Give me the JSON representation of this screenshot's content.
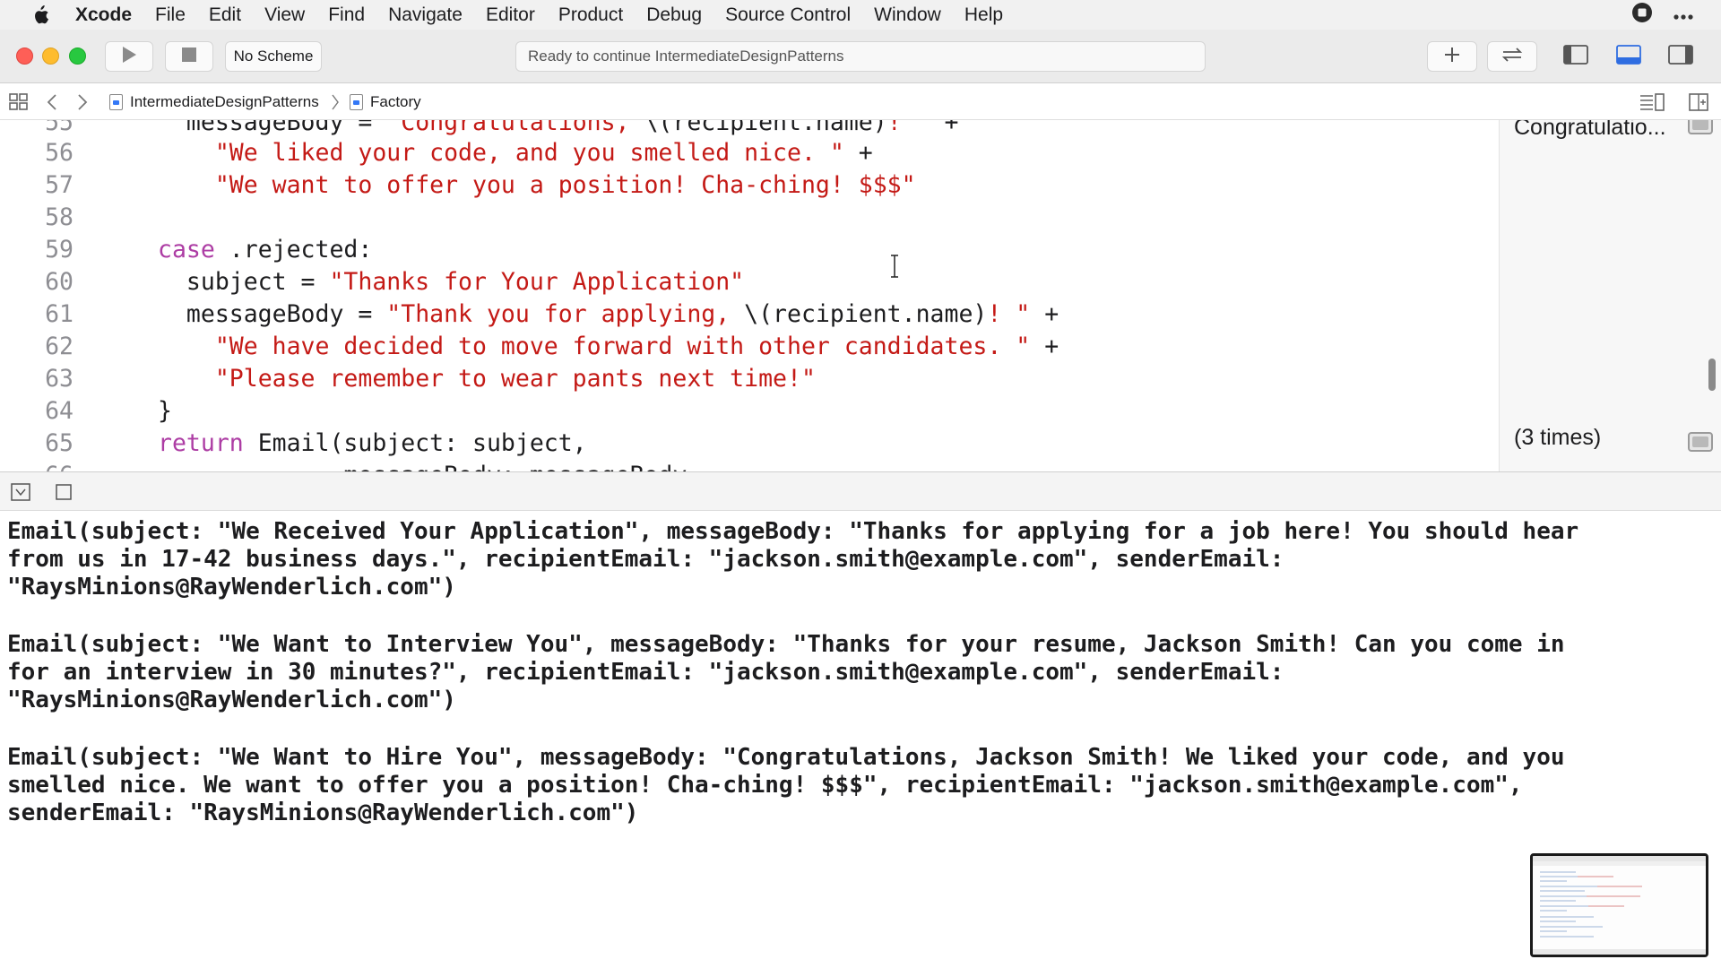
{
  "menubar": {
    "app_name": "Xcode",
    "items": [
      "File",
      "Edit",
      "View",
      "Find",
      "Navigate",
      "Editor",
      "Product",
      "Debug",
      "Source Control",
      "Window",
      "Help"
    ]
  },
  "toolbar": {
    "scheme_label": "No Scheme",
    "activity_status": "Ready to continue IntermediateDesignPatterns"
  },
  "jumpbar": {
    "project": "IntermediateDesignPatterns",
    "file": "Factory"
  },
  "editor": {
    "lines": [
      {
        "num": "55",
        "parts": [
          {
            "t": "  messageBody = ",
            "c": "plain"
          },
          {
            "t": "\"Congratulations, ",
            "c": "str"
          },
          {
            "t": "\\(recipient.name)",
            "c": "plain"
          },
          {
            "t": "! \"",
            "c": "str"
          },
          {
            "t": " +",
            "c": "plain"
          }
        ]
      },
      {
        "num": "56",
        "parts": [
          {
            "t": "    ",
            "c": "plain"
          },
          {
            "t": "\"We liked your code, and you smelled nice. \"",
            "c": "str"
          },
          {
            "t": " +",
            "c": "plain"
          }
        ]
      },
      {
        "num": "57",
        "parts": [
          {
            "t": "    ",
            "c": "plain"
          },
          {
            "t": "\"We want to offer you a position! Cha-ching! $$$\"",
            "c": "str"
          }
        ]
      },
      {
        "num": "58",
        "parts": []
      },
      {
        "num": "59",
        "parts": [
          {
            "t": "case",
            "c": "kw"
          },
          {
            "t": " .rejected:",
            "c": "plain"
          }
        ]
      },
      {
        "num": "60",
        "parts": [
          {
            "t": "  subject = ",
            "c": "plain"
          },
          {
            "t": "\"Thanks for Your Application\"",
            "c": "str"
          }
        ]
      },
      {
        "num": "61",
        "parts": [
          {
            "t": "  messageBody = ",
            "c": "plain"
          },
          {
            "t": "\"Thank you for applying, ",
            "c": "str"
          },
          {
            "t": "\\(recipient.name)",
            "c": "plain"
          },
          {
            "t": "! \"",
            "c": "str"
          },
          {
            "t": " +",
            "c": "plain"
          }
        ]
      },
      {
        "num": "62",
        "parts": [
          {
            "t": "    ",
            "c": "plain"
          },
          {
            "t": "\"We have decided to move forward with other candidates. \"",
            "c": "str"
          },
          {
            "t": " +",
            "c": "plain"
          }
        ]
      },
      {
        "num": "63",
        "parts": [
          {
            "t": "    ",
            "c": "plain"
          },
          {
            "t": "\"Please remember to wear pants next time!\"",
            "c": "str"
          }
        ]
      },
      {
        "num": "64",
        "parts": [
          {
            "t": "}",
            "c": "plain"
          }
        ]
      },
      {
        "num": "65",
        "parts": [
          {
            "t": "return",
            "c": "kw"
          },
          {
            "t": " Email(subject: subject,",
            "c": "plain"
          }
        ]
      },
      {
        "num": "66",
        "parts": [
          {
            "t": "             messageBody: messageBody,",
            "c": "plain"
          }
        ]
      }
    ]
  },
  "results": {
    "line55": "Congratulatio...",
    "line65": "(3 times)"
  },
  "console": {
    "lines": [
      "Email(subject: \"We Received Your Application\", messageBody: \"Thanks for applying for a job here! You should hear",
      "from us in 17-42 business days.\", recipientEmail: \"jackson.smith@example.com\", senderEmail:",
      "\"RaysMinions@RayWenderlich.com\")",
      "",
      "Email(subject: \"We Want to Interview You\", messageBody: \"Thanks for your resume, Jackson Smith! Can you come in",
      "for an interview in 30 minutes?\", recipientEmail: \"jackson.smith@example.com\", senderEmail:",
      "\"RaysMinions@RayWenderlich.com\")",
      "",
      "Email(subject: \"We Want to Hire You\", messageBody: \"Congratulations, Jackson Smith! We liked your code, and you",
      "smelled nice. We want to offer you a position! Cha-ching! $$$\", recipientEmail: \"jackson.smith@example.com\",",
      "senderEmail: \"RaysMinions@RayWenderlich.com\")"
    ]
  },
  "colors": {
    "string": "#c41a16",
    "keyword": "#ad3da4",
    "line_number": "#8e8e93",
    "close": "#fe5f57",
    "minimize": "#febc2e",
    "zoom": "#28c840"
  }
}
